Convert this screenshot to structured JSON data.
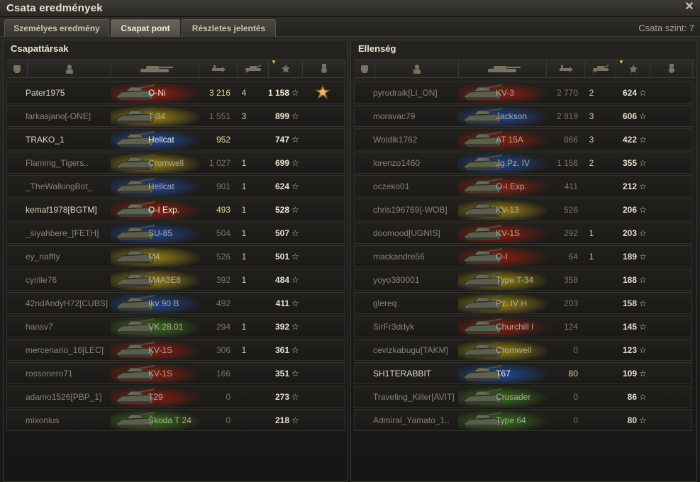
{
  "window": {
    "title": "Csata eredmények",
    "close_icon": "close-icon"
  },
  "tabs": [
    {
      "label": "Személyes eredmény",
      "active": false
    },
    {
      "label": "Csapat pont",
      "active": true
    },
    {
      "label": "Részletes jelentés",
      "active": false
    }
  ],
  "battle_level": "Csata szint: 7",
  "colors": {
    "gold": "#e5d49b",
    "red": "#8c1f12",
    "green": "#3f7a1f",
    "yellow": "#a08a12",
    "blue": "#1f4c9c"
  },
  "column_icons": [
    "vehicle-class-icon",
    "player-icon",
    "tank-icon",
    "damage-icon",
    "kills-icon",
    "xp-star-icon",
    "medal-icon"
  ],
  "allies": {
    "title": "Csapattársak",
    "players": [
      {
        "name": "Pater1975",
        "tank": "O-Ni",
        "damage": "3 216",
        "kills": "4",
        "xp": "1 158",
        "color": "red",
        "medal": true,
        "dim": false
      },
      {
        "name": "farkasjano[-ONE]",
        "tank": "T-34",
        "damage": "1 551",
        "kills": "3",
        "xp": "899",
        "color": "yellow",
        "medal": false,
        "dim": true
      },
      {
        "name": "TRAKO_1",
        "tank": "Hellcat",
        "damage": "952",
        "kills": "",
        "xp": "747",
        "color": "blue",
        "medal": false,
        "dim": false
      },
      {
        "name": "Flaming_Tigers..",
        "tank": "Cromwell",
        "damage": "1 027",
        "kills": "1",
        "xp": "699",
        "color": "yellow",
        "medal": false,
        "dim": true
      },
      {
        "name": "_TheWalkingBot_",
        "tank": "Hellcat",
        "damage": "901",
        "kills": "1",
        "xp": "624",
        "color": "blue",
        "medal": false,
        "dim": true
      },
      {
        "name": "kemaf1978[BGTM]",
        "tank": "O-I Exp.",
        "damage": "493",
        "kills": "1",
        "xp": "528",
        "color": "red",
        "medal": false,
        "dim": false
      },
      {
        "name": "_siyahbere_[FETH]",
        "tank": "SU-85",
        "damage": "504",
        "kills": "1",
        "xp": "507",
        "color": "blue",
        "medal": false,
        "dim": true
      },
      {
        "name": "ey_naffty",
        "tank": "M4",
        "damage": "526",
        "kills": "1",
        "xp": "501",
        "color": "yellow",
        "medal": false,
        "dim": true
      },
      {
        "name": "cyrille76",
        "tank": "M4A3E8",
        "damage": "392",
        "kills": "1",
        "xp": "484",
        "color": "yellow",
        "medal": false,
        "dim": true
      },
      {
        "name": "42ndAndyH72[CUBS]",
        "tank": "Ikv 90 B",
        "damage": "492",
        "kills": "",
        "xp": "411",
        "color": "blue",
        "medal": false,
        "dim": true
      },
      {
        "name": "hansv7",
        "tank": "VK 28.01",
        "damage": "294",
        "kills": "1",
        "xp": "392",
        "color": "green",
        "medal": false,
        "dim": true
      },
      {
        "name": "mercenario_16[LEC]",
        "tank": "KV-1S",
        "damage": "306",
        "kills": "1",
        "xp": "361",
        "color": "red",
        "medal": false,
        "dim": true
      },
      {
        "name": "rossonero71",
        "tank": "KV-1S",
        "damage": "166",
        "kills": "",
        "xp": "351",
        "color": "red",
        "medal": false,
        "dim": true
      },
      {
        "name": "adamo1526[PBP_1]",
        "tank": "T29",
        "damage": "0",
        "kills": "",
        "xp": "273",
        "color": "red",
        "medal": false,
        "dim": true
      },
      {
        "name": "mixonius",
        "tank": "Škoda T 24",
        "damage": "0",
        "kills": "",
        "xp": "218",
        "color": "green",
        "medal": false,
        "dim": true
      }
    ]
  },
  "enemies": {
    "title": "Ellenség",
    "players": [
      {
        "name": "pyrodraik[LI_ON]",
        "tank": "KV-3",
        "damage": "2 770",
        "kills": "2",
        "xp": "624",
        "color": "red",
        "medal": false,
        "dim": true
      },
      {
        "name": "moravac79",
        "tank": "Jackson",
        "damage": "2 819",
        "kills": "3",
        "xp": "606",
        "color": "blue",
        "medal": false,
        "dim": true
      },
      {
        "name": "Woldik1762",
        "tank": "AT 15A",
        "damage": "866",
        "kills": "3",
        "xp": "422",
        "color": "red",
        "medal": false,
        "dim": true
      },
      {
        "name": "lorenzo1460",
        "tank": "Jg.Pz. IV",
        "damage": "1 156",
        "kills": "2",
        "xp": "355",
        "color": "blue",
        "medal": false,
        "dim": true
      },
      {
        "name": "oczeko01",
        "tank": "O-I Exp.",
        "damage": "411",
        "kills": "",
        "xp": "212",
        "color": "red",
        "medal": false,
        "dim": true
      },
      {
        "name": "chris196769[-WOB]",
        "tank": "KV-13",
        "damage": "526",
        "kills": "",
        "xp": "206",
        "color": "yellow",
        "medal": false,
        "dim": true
      },
      {
        "name": "doomood[UGNIS]",
        "tank": "KV-1S",
        "damage": "292",
        "kills": "1",
        "xp": "203",
        "color": "red",
        "medal": false,
        "dim": true
      },
      {
        "name": "mackandre56",
        "tank": "O-I",
        "damage": "64",
        "kills": "1",
        "xp": "189",
        "color": "red",
        "medal": false,
        "dim": true
      },
      {
        "name": "yoyo380001",
        "tank": "Type T-34",
        "damage": "358",
        "kills": "",
        "xp": "188",
        "color": "yellow",
        "medal": false,
        "dim": true
      },
      {
        "name": "glereq",
        "tank": "Pz. IV H",
        "damage": "203",
        "kills": "",
        "xp": "158",
        "color": "yellow",
        "medal": false,
        "dim": true
      },
      {
        "name": "SirFr3ddyk",
        "tank": "Churchill I",
        "damage": "124",
        "kills": "",
        "xp": "145",
        "color": "red",
        "medal": false,
        "dim": true
      },
      {
        "name": "cevizkabugu[TAKM]",
        "tank": "Cromwell",
        "damage": "0",
        "kills": "",
        "xp": "123",
        "color": "yellow",
        "medal": false,
        "dim": true
      },
      {
        "name": "SH1TERABBIT",
        "tank": "T67",
        "damage": "80",
        "kills": "",
        "xp": "109",
        "color": "blue",
        "medal": false,
        "dim": false
      },
      {
        "name": "Traveling_Killer[AVIT]",
        "tank": "Crusader",
        "damage": "0",
        "kills": "",
        "xp": "86",
        "color": "green",
        "medal": false,
        "dim": true
      },
      {
        "name": "Admiral_Yamato_1..",
        "tank": "Type 64",
        "damage": "0",
        "kills": "",
        "xp": "80",
        "color": "green",
        "medal": false,
        "dim": true
      }
    ]
  }
}
